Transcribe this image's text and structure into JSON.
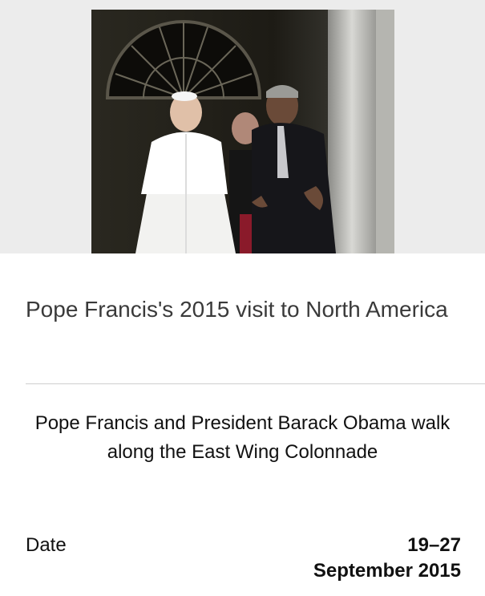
{
  "article": {
    "title": "Pope Francis's 2015 visit to North America",
    "image_caption": "Pope Francis and President Barack Obama walk along the East Wing Colonnade"
  },
  "info": {
    "label": "Date",
    "value_line1": "19–27",
    "value_line2": "September 2015"
  }
}
